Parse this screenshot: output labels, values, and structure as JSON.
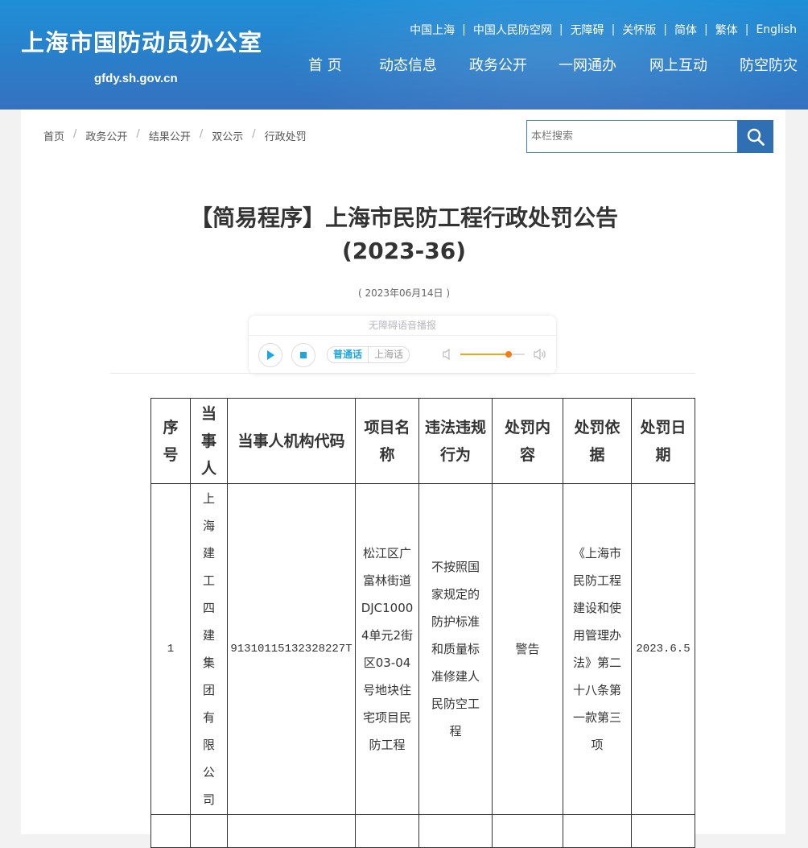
{
  "header": {
    "site_title": "上海市国防动员办公室",
    "site_domain": "gfdy.sh.gov.cn",
    "top_links": [
      "中国上海",
      "中国人民防空网",
      "无障碍",
      "关怀版",
      "简体",
      "繁体",
      "English"
    ],
    "nav": [
      "首 页",
      "动态信息",
      "政务公开",
      "一网通办",
      "网上互动",
      "防空防灾"
    ]
  },
  "breadcrumb": [
    "首页",
    "政务公开",
    "结果公开",
    "双公示",
    "行政处罚"
  ],
  "search": {
    "placeholder": "本栏搜索"
  },
  "article": {
    "title_line1": "【简易程序】上海市民防工程行政处罚公告",
    "title_line2": "(2023-36)",
    "date": "( 2023年06月14日 )"
  },
  "player": {
    "heading": "无障碍语音播报",
    "lang_active": "普通话",
    "lang_other": "上海话",
    "volume": 0.75,
    "accent_color": "#1ea6e0",
    "volume_color": "#f37e16"
  },
  "table": {
    "headers": [
      "序号",
      "当事人",
      "当事人机构代码",
      "项目名称",
      "违法违规行为",
      "处罚内容",
      "处罚依据",
      "处罚日期"
    ],
    "rows": [
      {
        "index": "1",
        "party": "上海建工四建集团有限公司",
        "org_code": "91310115132328227T",
        "project": "松江区广富林街道DJC10004单元2街区03-04号地块住宅项目民防工程",
        "violation": "不按照国家规定的防护标准和质量标准修建人民防空工程",
        "penalty": "警告",
        "basis": "《上海市民防工程建设和使用管理办法》第二十八条第一款第三项",
        "date": "2023.6.5"
      }
    ]
  },
  "colors": {
    "header_top": "#1f8fd8",
    "header_bottom": "#3572c0",
    "search_button": "#2f6fb3"
  }
}
